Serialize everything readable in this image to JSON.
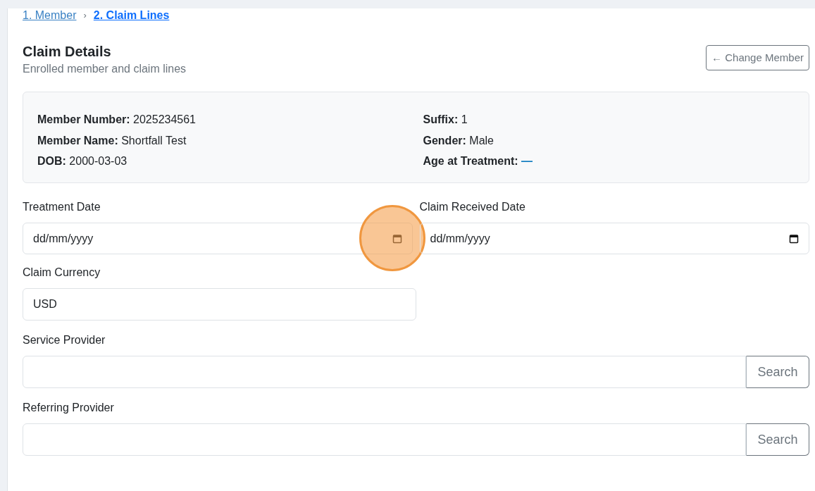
{
  "breadcrumb": [
    {
      "label": "1. Member",
      "selected": false
    },
    {
      "label": "2. Claim Lines",
      "selected": true
    }
  ],
  "breadcrumb_separator": "›",
  "header": {
    "title": "Claim Details",
    "subtitle": "Enrolled member and claim lines",
    "button": "← Change Member"
  },
  "member": {
    "left": [
      {
        "label": "Member Number:",
        "value": "2025234561"
      },
      {
        "label": "Member Name:",
        "value": "Shortfall Test"
      },
      {
        "label": "DOB:",
        "value": "2000-03-03"
      }
    ],
    "right": [
      {
        "label": "Suffix:",
        "value": "1",
        "kind": "plain"
      },
      {
        "label": "Gender:",
        "value": "Male",
        "kind": "plain"
      },
      {
        "label": "Age at Treatment:",
        "value": "—",
        "kind": "link"
      }
    ]
  },
  "dates": [
    {
      "label": "Treatment Date",
      "placeholder": "dd/mm/yyyy",
      "highlighted": true
    },
    {
      "label": "Claim Received Date",
      "placeholder": "dd/mm/yyyy",
      "highlighted": false
    }
  ],
  "currency": {
    "label": "Claim Currency",
    "value": "USD"
  },
  "providers": [
    {
      "label": "Service Provider",
      "button": "Search"
    },
    {
      "label": "Referring Provider",
      "button": "Search"
    }
  ]
}
